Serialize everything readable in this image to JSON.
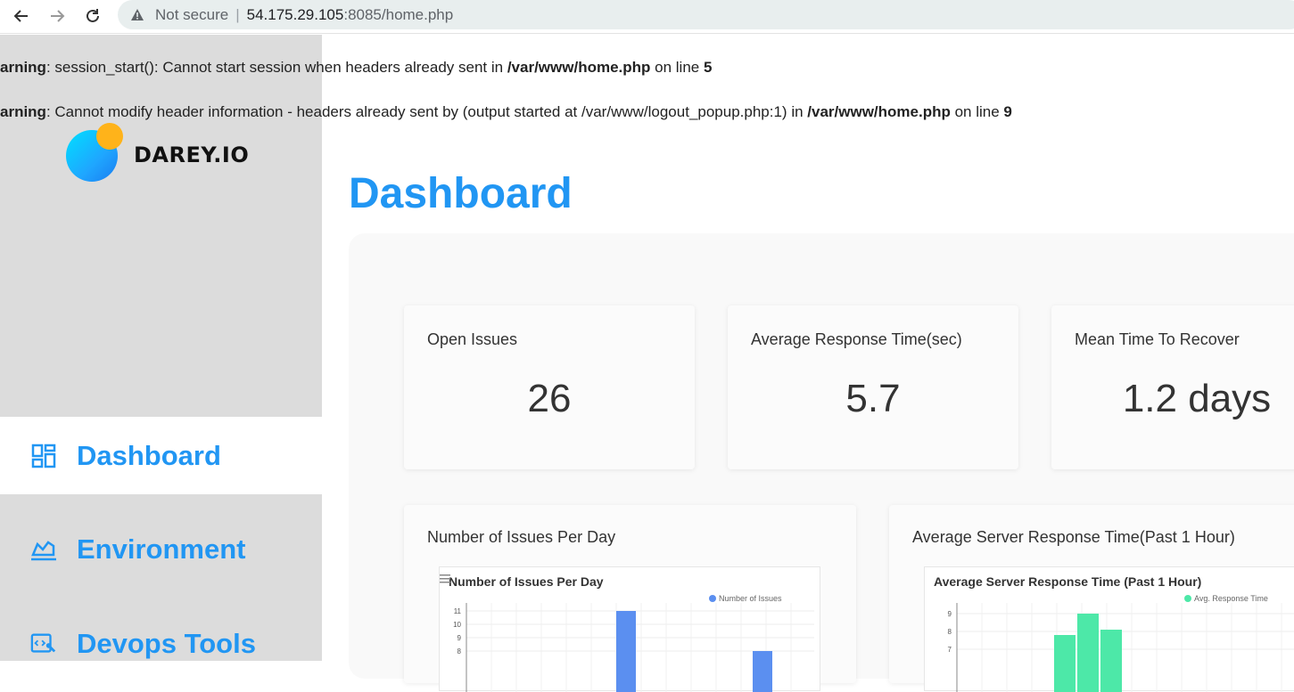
{
  "browser": {
    "security_label": "Not secure",
    "separator": "|",
    "host": "54.175.29.105",
    "path": ":8085/home.php"
  },
  "warnings": [
    {
      "prefix": "arning",
      "text1": ": session_start(): Cannot start session when headers already sent in ",
      "bold_path": "/var/www/home.php",
      "text2": " on line ",
      "line": "5"
    },
    {
      "prefix": "arning",
      "text1": ": Cannot modify header information - headers already sent by (output started at /var/www/logout_popup.php:1) in ",
      "bold_path": "/var/www/home.php",
      "text2": " on line ",
      "line": "9"
    }
  ],
  "logo": {
    "brand": "DAREY.IO"
  },
  "sidebar": {
    "items": [
      {
        "label": "Dashboard",
        "icon": "dashboard-icon",
        "active": true
      },
      {
        "label": "Environment",
        "icon": "area-chart-icon",
        "active": false
      },
      {
        "label": "Devops Tools",
        "icon": "code-tools-icon",
        "active": false
      }
    ]
  },
  "main": {
    "title": "Dashboard",
    "stats": [
      {
        "title": "Open Issues",
        "value": "26"
      },
      {
        "title": "Average Response Time(sec)",
        "value": "5.7"
      },
      {
        "title": "Mean Time To Recover",
        "value": "1.2 days"
      }
    ],
    "charts": [
      {
        "card_title": "Number of Issues Per Day",
        "chart_title": "Number of Issues Per Day",
        "legend": "Number of Issues"
      },
      {
        "card_title": "Average Server Response Time(Past 1 Hour)",
        "chart_title": "Average Server Response Time (Past 1 Hour)",
        "legend": "Avg. Response Time"
      }
    ]
  },
  "colors": {
    "accent": "#2196f3",
    "issues_series": "#5b8ff0",
    "response_series": "#4de8a8"
  },
  "chart_data": [
    {
      "type": "bar",
      "title": "Number of Issues Per Day",
      "series": [
        {
          "name": "Number of Issues",
          "values": [
            11,
            8
          ]
        }
      ],
      "y_ticks": [
        "11",
        "10",
        "9",
        "8"
      ],
      "ylim": [
        7,
        11
      ]
    },
    {
      "type": "bar",
      "title": "Average Server Response Time (Past 1 Hour)",
      "series": [
        {
          "name": "Avg. Response Time",
          "values": [
            7.8,
            9,
            8.1
          ]
        }
      ],
      "y_ticks": [
        "9",
        "8",
        "7"
      ],
      "ylim": [
        6.5,
        9
      ]
    }
  ]
}
